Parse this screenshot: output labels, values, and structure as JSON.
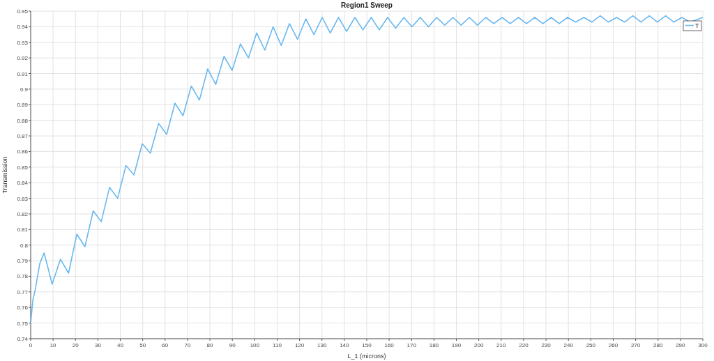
{
  "chart_data": {
    "type": "line",
    "title": "Region1 Sweep",
    "xlabel": "L_1 (microns)",
    "ylabel": "Transmission",
    "x": [
      0,
      1,
      2,
      4,
      6,
      9.6,
      13.3,
      16.9,
      20.6,
      24.2,
      27.9,
      31.5,
      35.2,
      38.8,
      42.5,
      46.1,
      49.8,
      53.4,
      57.1,
      60.7,
      64.4,
      68,
      71.7,
      75.3,
      79,
      82.6,
      86.3,
      89.9,
      93.6,
      97.2,
      100.9,
      104.5,
      108.2,
      111.8,
      115.5,
      119.1,
      122.8,
      126.4,
      130.1,
      133.7,
      137.4,
      141,
      144.7,
      148.3,
      152,
      155.6,
      159.3,
      162.9,
      166.6,
      170.2,
      173.9,
      177.5,
      181.2,
      184.8,
      188.5,
      192.1,
      195.8,
      199.4,
      203.1,
      206.7,
      210.4,
      214,
      217.7,
      221.3,
      225,
      228.6,
      232.3,
      235.9,
      239.6,
      243.2,
      246.9,
      250.5,
      254.2,
      257.8,
      261.5,
      265.1,
      268.8,
      272.4,
      276.1,
      279.7,
      283.4,
      287,
      290.7,
      294.3,
      300
    ],
    "series": [
      {
        "name": "T",
        "color": "#6ab8f0",
        "values": [
          0.75,
          0.765,
          0.771,
          0.788,
          0.795,
          0.775,
          0.791,
          0.782,
          0.807,
          0.799,
          0.822,
          0.815,
          0.837,
          0.83,
          0.851,
          0.845,
          0.865,
          0.859,
          0.878,
          0.871,
          0.891,
          0.883,
          0.902,
          0.893,
          0.913,
          0.903,
          0.921,
          0.912,
          0.929,
          0.92,
          0.936,
          0.925,
          0.94,
          0.928,
          0.942,
          0.932,
          0.945,
          0.935,
          0.946,
          0.936,
          0.946,
          0.937,
          0.946,
          0.938,
          0.946,
          0.938,
          0.946,
          0.939,
          0.946,
          0.94,
          0.946,
          0.94,
          0.946,
          0.941,
          0.946,
          0.941,
          0.946,
          0.941,
          0.946,
          0.942,
          0.946,
          0.942,
          0.946,
          0.942,
          0.946,
          0.942,
          0.946,
          0.942,
          0.946,
          0.943,
          0.946,
          0.943,
          0.947,
          0.943,
          0.946,
          0.943,
          0.947,
          0.943,
          0.947,
          0.943,
          0.947,
          0.943,
          0.946,
          0.943,
          0.946
        ]
      }
    ],
    "grid": true,
    "xlim": [
      0,
      300
    ],
    "ylim": [
      0.74,
      0.95
    ],
    "xticks": [
      0,
      10,
      20,
      30,
      40,
      50,
      60,
      70,
      80,
      90,
      100,
      110,
      120,
      130,
      140,
      150,
      160,
      170,
      180,
      190,
      200,
      210,
      220,
      230,
      240,
      250,
      260,
      270,
      280,
      290,
      300
    ],
    "yticks": [
      0.74,
      0.75,
      0.76,
      0.77,
      0.78,
      0.79,
      0.8,
      0.81,
      0.82,
      0.83,
      0.84,
      0.85,
      0.86,
      0.87,
      0.88,
      0.89,
      0.9,
      0.91,
      0.92,
      0.93,
      0.94,
      0.95
    ]
  }
}
